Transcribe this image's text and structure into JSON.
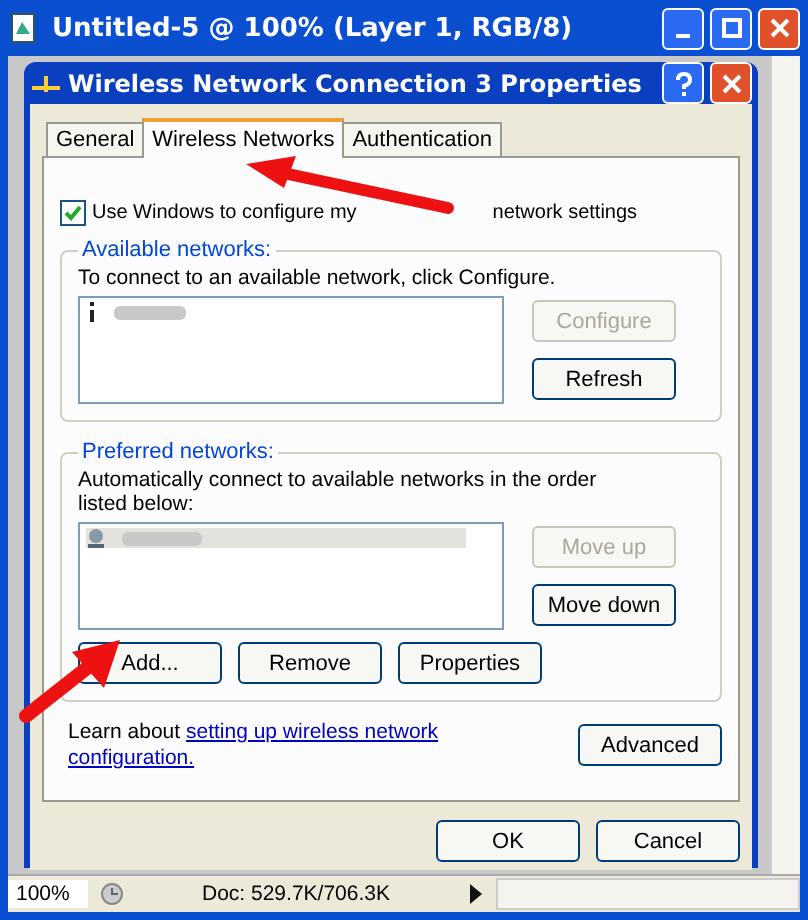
{
  "window": {
    "title": "Untitled-5 @ 100% (Layer 1, RGB/8)"
  },
  "dialog": {
    "title": "Wireless Network Connection 3 Properties",
    "tabs": [
      {
        "label": "General",
        "selected": false
      },
      {
        "label": "Wireless Networks",
        "selected": true
      },
      {
        "label": "Authentication",
        "selected": false
      }
    ],
    "use_windows": {
      "label_parts": [
        "Use Windows to configure my",
        "network settings"
      ],
      "checked": true
    },
    "available": {
      "title": "Available networks:",
      "hint": "To connect to an available network, click Configure.",
      "buttons": [
        {
          "label": "Configure",
          "disabled": true
        },
        {
          "label": "Refresh",
          "disabled": false
        }
      ]
    },
    "preferred": {
      "title": "Preferred networks:",
      "hint": "Automatically connect to available networks in the order listed below:",
      "side_buttons": [
        {
          "label": "Move up",
          "disabled": true
        },
        {
          "label": "Move down",
          "disabled": false
        }
      ],
      "buttons": [
        "Add...",
        "Remove",
        "Properties"
      ]
    },
    "learn": {
      "text": "Learn about",
      "link_lines": [
        "setting up wireless network",
        "configuration."
      ]
    },
    "advanced": "Advanced",
    "footer_buttons": [
      "OK",
      "Cancel"
    ]
  },
  "status_bar": {
    "zoom": "100%",
    "doc": "Doc: 529.7K/706.3K"
  }
}
